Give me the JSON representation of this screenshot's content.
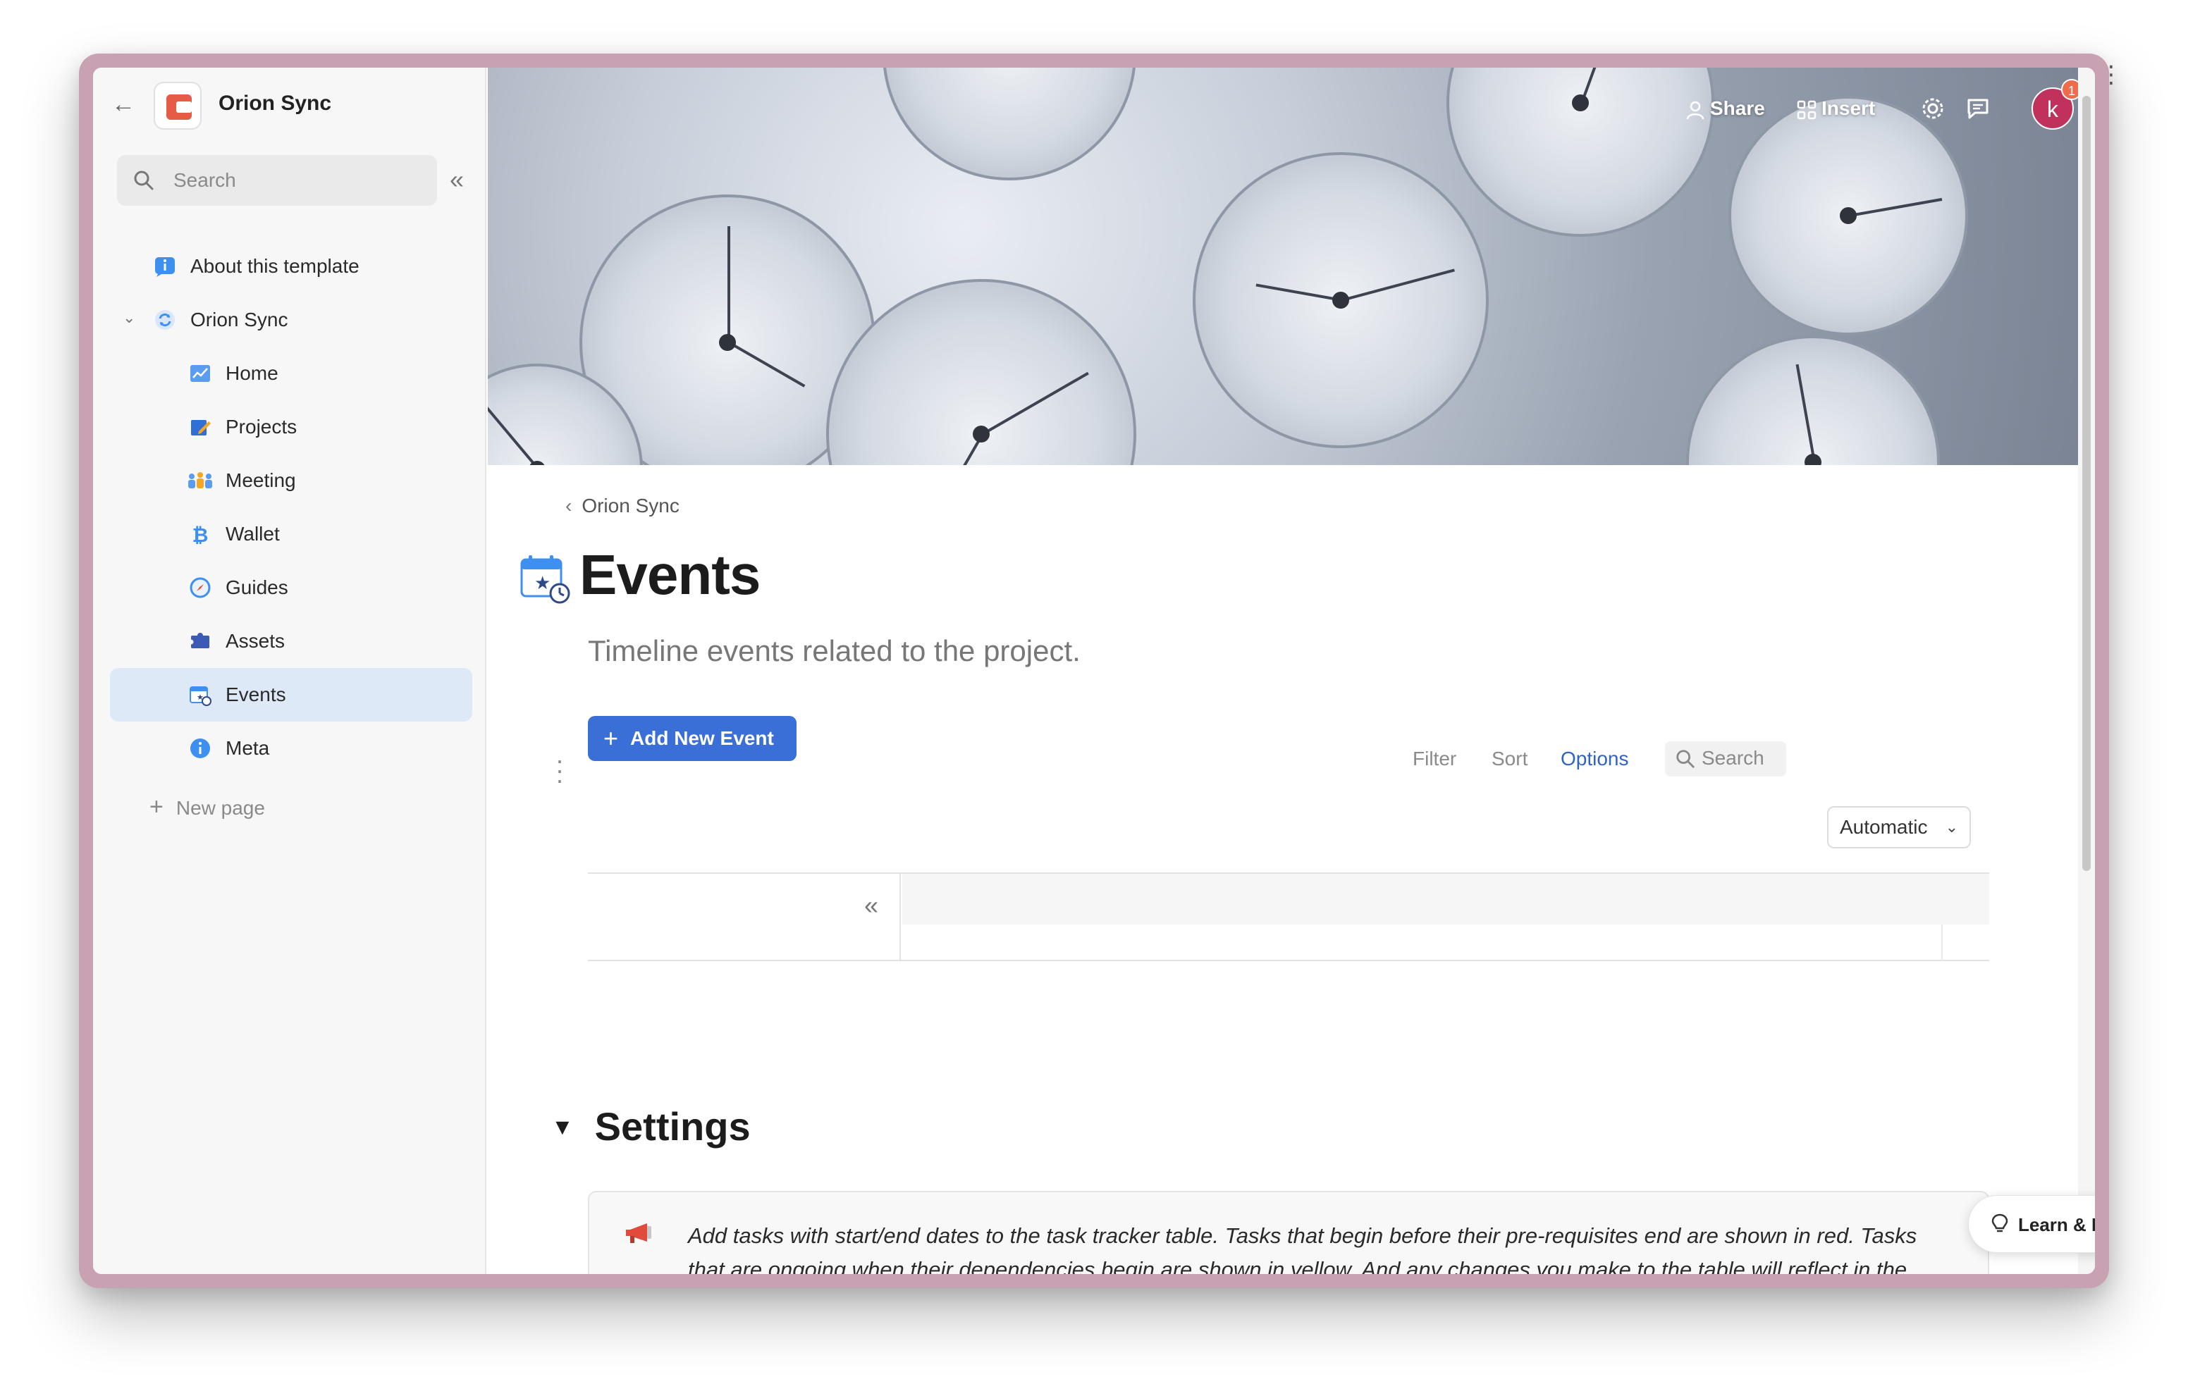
{
  "app": {
    "name": "Orion Sync"
  },
  "sidebar": {
    "search_placeholder": "Search",
    "items": [
      {
        "label": "About this template",
        "icon": "info-chat-icon"
      },
      {
        "label": "Orion Sync",
        "icon": "sync-icon"
      },
      {
        "label": "Home",
        "icon": "chart-icon"
      },
      {
        "label": "Projects",
        "icon": "pencil-icon"
      },
      {
        "label": "Meeting",
        "icon": "people-icon"
      },
      {
        "label": "Wallet",
        "icon": "bitcoin-icon"
      },
      {
        "label": "Guides",
        "icon": "compass-icon"
      },
      {
        "label": "Assets",
        "icon": "puzzle-icon"
      },
      {
        "label": "Events",
        "icon": "calendar-icon"
      },
      {
        "label": "Meta",
        "icon": "info-icon"
      }
    ],
    "new_page_label": "New page"
  },
  "topbar": {
    "share_label": "Share",
    "insert_label": "Insert",
    "avatar_initial": "k",
    "notification_count": "1"
  },
  "page": {
    "breadcrumb": "Orion Sync",
    "title": "Events",
    "subtitle": "Timeline events related to the project.",
    "add_button_label": "Add New Event"
  },
  "toolbar": {
    "filter_label": "Filter",
    "sort_label": "Sort",
    "options_label": "Options",
    "search_label": "Search"
  },
  "timeline": {
    "scale_value": "Automatic"
  },
  "settings": {
    "heading": "Settings",
    "callout_text": "Add tasks with start/end dates to the task tracker table. Tasks that begin before their pre-requisites end are shown in red. Tasks that are ongoing when their dependencies begin are shown in yellow. And any changes you make to the table will reflect in the timeline below."
  },
  "help": {
    "label": "Learn & Help"
  },
  "colors": {
    "accent": "#3b6fd8",
    "active_nav": "#dde9f7",
    "frame": "#c8a1b3",
    "avatar": "#c0325c"
  }
}
